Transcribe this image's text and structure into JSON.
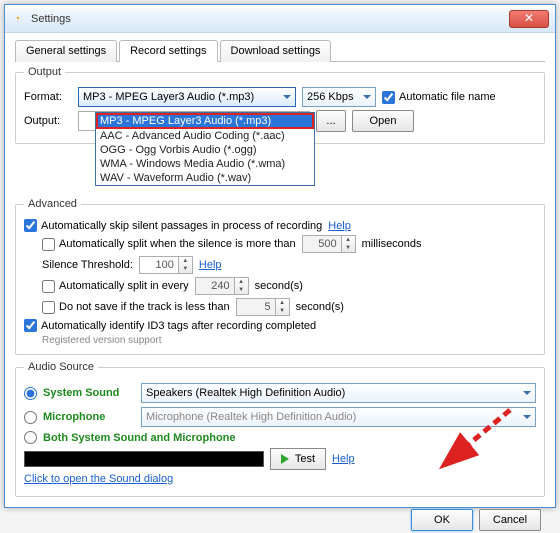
{
  "window": {
    "title": "Settings"
  },
  "tabs": {
    "general": "General settings",
    "record": "Record settings",
    "download": "Download settings"
  },
  "output": {
    "legend": "Output",
    "format_label": "Format:",
    "format_selected": "MP3 - MPEG Layer3 Audio (*.mp3)",
    "options": [
      "MP3 - MPEG Layer3 Audio (*.mp3)",
      "AAC - Advanced Audio Coding (*.aac)",
      "OGG - Ogg Vorbis Audio (*.ogg)",
      "WMA - Windows Media Audio (*.wma)",
      "WAV - Waveform Audio (*.wav)"
    ],
    "bitrate": "256 Kbps",
    "auto_name_label": "Automatic file name",
    "output_label": "Output:",
    "browse": "...",
    "open": "Open"
  },
  "advanced": {
    "legend": "Advanced",
    "skip_silent": "Automatically skip silent passages in process of recording",
    "help": "Help",
    "auto_split_silence_pre": "Automatically split when the silence is more than",
    "auto_split_silence_val": "500",
    "auto_split_silence_post": "milliseconds",
    "silence_threshold_label": "Silence Threshold:",
    "silence_threshold_val": "100",
    "auto_split_every_pre": "Automatically split in every",
    "auto_split_every_val": "240",
    "auto_split_every_post": "second(s)",
    "dont_save_pre": "Do not save if the track is less than",
    "dont_save_val": "5",
    "dont_save_post": "second(s)",
    "id3": "Automatically identify ID3 tags after recording completed",
    "note": "Registered version support"
  },
  "audio": {
    "legend": "Audio Source",
    "system": "System Sound",
    "system_device": "Speakers (Realtek High Definition Audio)",
    "mic": "Microphone",
    "mic_device": "Microphone (Realtek High Definition Audio)",
    "both": "Both System Sound and Microphone",
    "test": "Test",
    "help": "Help",
    "sound_dialog": "Click to open the Sound dialog"
  },
  "footer": {
    "ok": "OK",
    "cancel": "Cancel"
  }
}
